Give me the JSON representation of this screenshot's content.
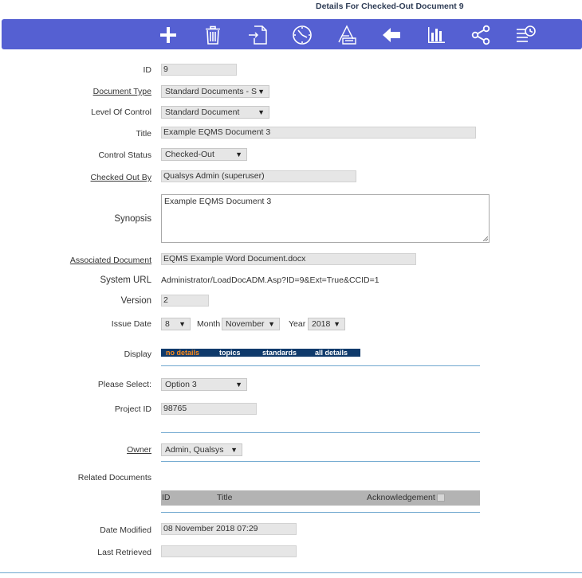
{
  "header": {
    "title": "Details For Checked-Out Document 9"
  },
  "toolbar": {
    "icons": [
      "add-icon",
      "trash-icon",
      "checkin-document-icon",
      "clock-icon",
      "review-document-icon",
      "back-arrow-icon",
      "bar-chart-icon",
      "share-icon",
      "history-list-icon"
    ],
    "background": "#5560d2"
  },
  "form": {
    "id": {
      "label": "ID",
      "value": "9"
    },
    "document_type": {
      "label": "Document Type",
      "value": "Standard Documents - S"
    },
    "level_of_control": {
      "label": "Level Of Control",
      "value": "Standard Document"
    },
    "title": {
      "label": "Title",
      "value": "Example EQMS Document 3"
    },
    "control_status": {
      "label": "Control Status",
      "value": "Checked-Out"
    },
    "checked_out_by": {
      "label": "Checked Out By",
      "value": "Qualsys Admin (superuser)"
    },
    "synopsis": {
      "label": "Synopsis",
      "value": "Example EQMS Document 3"
    },
    "associated_document": {
      "label": "Associated Document",
      "value": "EQMS Example Word Document.docx"
    },
    "system_url": {
      "label": "System URL",
      "value": "Administrator/LoadDocADM.Asp?ID=9&Ext=True&CCID=1"
    },
    "version": {
      "label": "Version",
      "value": "2"
    },
    "issue_date": {
      "label": "Issue Date",
      "day": "8",
      "month_label": "Month",
      "month": "November",
      "year_label": "Year",
      "year": "2018"
    },
    "display": {
      "label": "Display",
      "options": [
        "no details",
        "topics",
        "standards",
        "all details"
      ],
      "active": "no details",
      "active_color": "#ff8c1a"
    },
    "please_select": {
      "label": "Please Select:",
      "value": "Option 3"
    },
    "project_id": {
      "label": "Project ID",
      "value": "98765"
    },
    "owner": {
      "label": "Owner",
      "value": "Admin, Qualsys"
    },
    "related_documents": {
      "label": "Related Documents",
      "columns": [
        "ID",
        "Title",
        "Acknowledgement"
      ]
    },
    "date_modified": {
      "label": "Date Modified",
      "value": "08 November 2018 07:29"
    },
    "last_retrieved": {
      "label": "Last Retrieved",
      "value": ""
    }
  },
  "select_arrow": "▼"
}
